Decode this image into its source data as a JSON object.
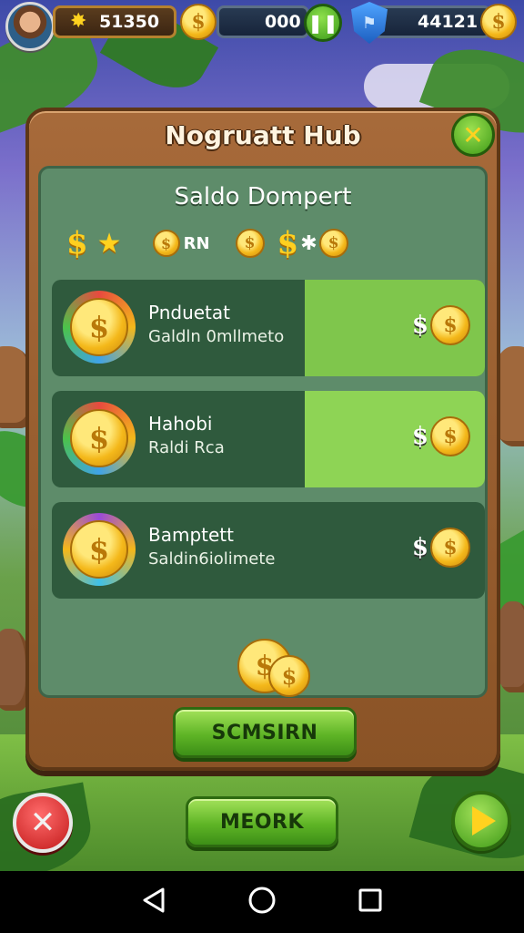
{
  "hud": {
    "gems": "51350",
    "coins": "000",
    "trophies": "44121"
  },
  "panel": {
    "title": "Nogruatt Hub",
    "subtitle": "Saldo Dompert",
    "currency_row": {
      "item2_text": "RN"
    }
  },
  "offers": [
    {
      "name": "Pnduetat",
      "desc": "Galdln 0mllmeto",
      "price_symbol": "$",
      "coin_glyph": "$"
    },
    {
      "name": "Hahobi",
      "desc": "Raldi Rca",
      "price_symbol": "$",
      "coin_glyph": "$"
    },
    {
      "name": "Bamptett",
      "desc": "Saldin6iolimete",
      "price_symbol": "$",
      "coin_glyph": "$"
    }
  ],
  "buttons": {
    "primary": "SCMSIRN",
    "secondary": "MEORK"
  },
  "colors": {
    "panel_wood": "#a76a3a",
    "inner_green": "#5e8c6a",
    "accent_green": "#5fb526",
    "gold": "#f4b81a",
    "close_red": "#c21a1a"
  },
  "icons": {
    "hud_gem": "star-burst-icon",
    "hud_coin": "coin-icon",
    "pause": "pause-icon",
    "shield": "shield-icon",
    "close": "close-icon",
    "cancel": "x-icon",
    "next": "play-arrow-icon"
  }
}
